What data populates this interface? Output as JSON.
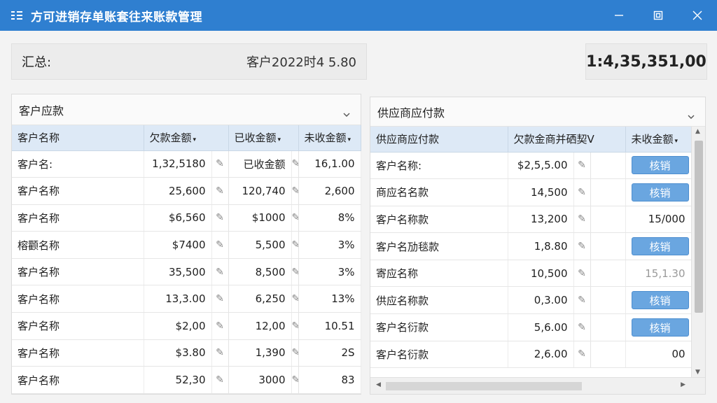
{
  "window": {
    "title": "方可进销存单账套往来账款管理"
  },
  "summary": {
    "label": "汇总:",
    "value": "客户2022时4 5.80",
    "total": "1:4,35,351,00"
  },
  "receivables": {
    "title": "客户应款",
    "columns": [
      "客户名称",
      "欠款金额",
      "已收金额",
      "未收金额"
    ],
    "rows": [
      {
        "name": "客户名:",
        "owed": "1,32,5180",
        "received": "已收金额",
        "unreceived": "16,1.00"
      },
      {
        "name": "客户名称",
        "owed": "25,600",
        "received": "120,740",
        "unreceived": "2,600"
      },
      {
        "name": "客户名称",
        "owed": "$6,560",
        "received": "$1000",
        "unreceived": "8%"
      },
      {
        "name": "榕颧名称",
        "owed": "$7400",
        "received": "5,500",
        "unreceived": "3%"
      },
      {
        "name": "客户名称",
        "owed": "35,500",
        "received": "8,500",
        "unreceived": "3%"
      },
      {
        "name": "客户名称",
        "owed": "13,3.00",
        "received": "6,250",
        "unreceived": "13%"
      },
      {
        "name": "客户名称",
        "owed": "$2,00",
        "received": "12,00",
        "unreceived": "10.51"
      },
      {
        "name": "客户名称",
        "owed": "$3.80",
        "received": "1,390",
        "unreceived": "2S"
      },
      {
        "name": "客户名称",
        "owed": "52,30",
        "received": "3000",
        "unreceived": "83"
      }
    ]
  },
  "payables": {
    "title": "供应商应付款",
    "columns": [
      "供应商应付款",
      "欠款金商并硒契V",
      "未收金额"
    ],
    "action_label": "核销",
    "rows": [
      {
        "name": "客户名称:",
        "owed": "$2,5,5.00",
        "status": "btn",
        "value": ""
      },
      {
        "name": "商应名名款",
        "owed": "14,500",
        "status": "btn",
        "value": ""
      },
      {
        "name": "客户名称款",
        "owed": "13,200",
        "status": "text",
        "value": "15/000"
      },
      {
        "name": "客户名劢毯款",
        "owed": "1,8.80",
        "status": "btn",
        "value": ""
      },
      {
        "name": "寄应名称",
        "owed": "10,500",
        "status": "muted",
        "value": "15,1.30"
      },
      {
        "name": "供应名称款",
        "owed": "0,3.00",
        "status": "btn",
        "value": ""
      },
      {
        "name": "客户名衍款",
        "owed": "5,6.00",
        "status": "btn",
        "value": ""
      },
      {
        "name": "客户名衍款",
        "owed": "2,6.00",
        "status": "text",
        "value": "00"
      }
    ]
  },
  "icons": {
    "pencil": "✎",
    "sort": "▾",
    "up": "▲",
    "down": "▼",
    "left": "◀",
    "right": "▶"
  }
}
